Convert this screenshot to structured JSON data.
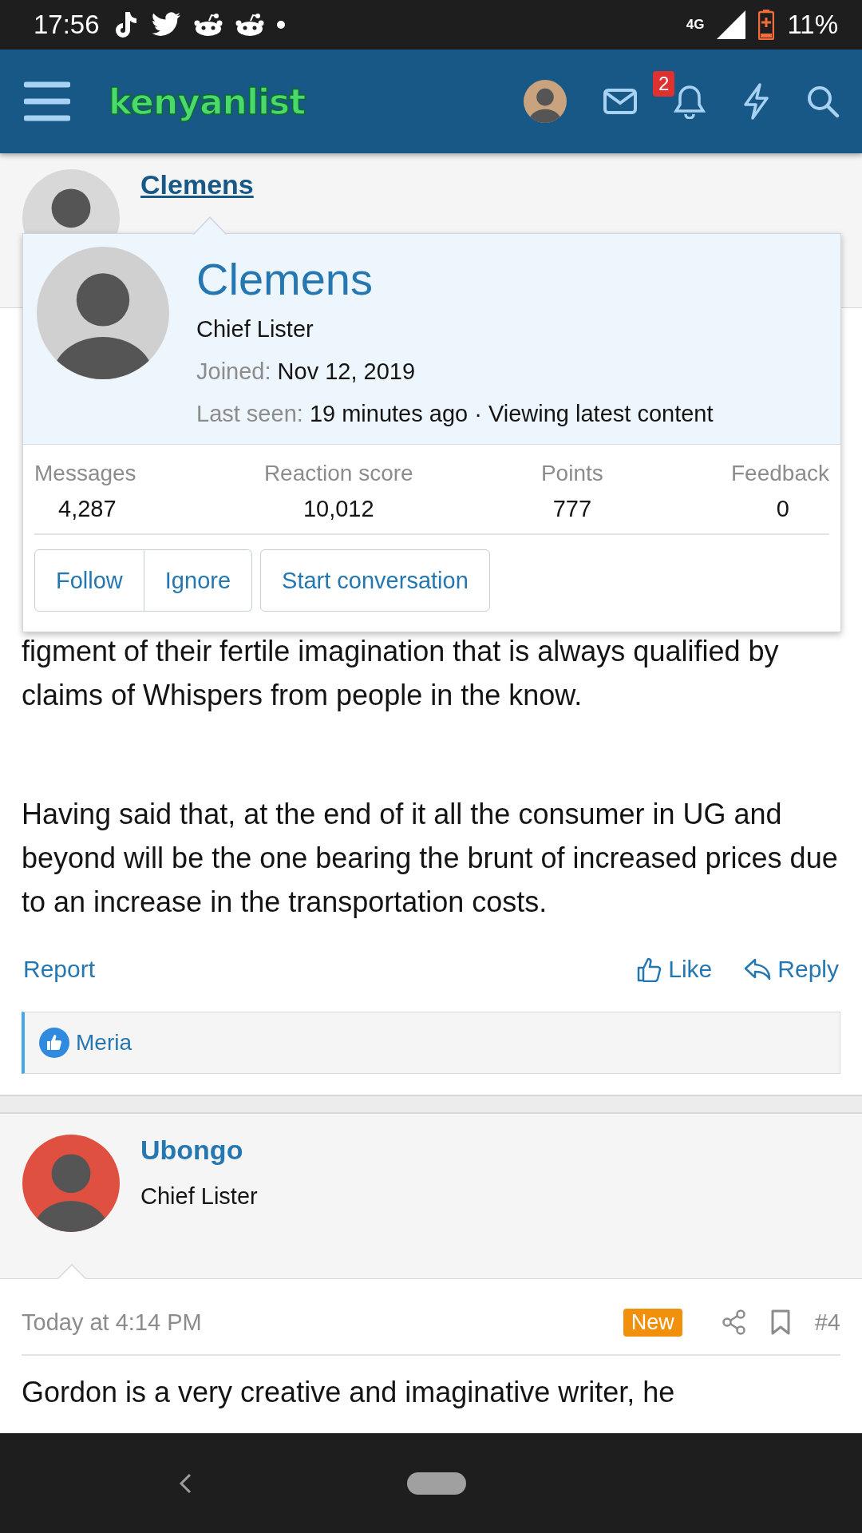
{
  "status_bar": {
    "time": "17:56",
    "network": "4G",
    "battery": "11%"
  },
  "header": {
    "logo": "kenyanlist",
    "notification_count": "2"
  },
  "posts": [
    {
      "author": {
        "name": "Clemens",
        "highlighted": true
      },
      "paragraphs": [
        "figment of their fertile imagination that is always qualified by claims of Whispers from people in the know.",
        "Having said that, at the end of it all the consumer in UG and beyond will be the one bearing the brunt of increased prices due to an increase in the transportation costs."
      ],
      "actions": {
        "report": "Report",
        "like": "Like",
        "reply": "Reply"
      },
      "reactions": [
        "Meria"
      ]
    },
    {
      "author": {
        "name": "Ubongo",
        "title": "Chief Lister",
        "highlighted": false
      },
      "date": "Today at 4:14 PM",
      "badge": "New",
      "number": "#4",
      "paragraphs": [
        "Gordon is a very creative and imaginative writer, he"
      ]
    }
  ],
  "member_popup": {
    "name": "Clemens",
    "title": "Chief Lister",
    "joined_label": "Joined:",
    "joined": "Nov 12, 2019",
    "last_seen_label": "Last seen:",
    "last_seen": "19 minutes ago · Viewing latest content",
    "stats": [
      {
        "label": "Messages",
        "value": "4,287"
      },
      {
        "label": "Reaction score",
        "value": "10,012"
      },
      {
        "label": "Points",
        "value": "777"
      },
      {
        "label": "Feedback",
        "value": "0"
      }
    ],
    "buttons": [
      "Follow",
      "Ignore",
      "Start conversation"
    ]
  }
}
